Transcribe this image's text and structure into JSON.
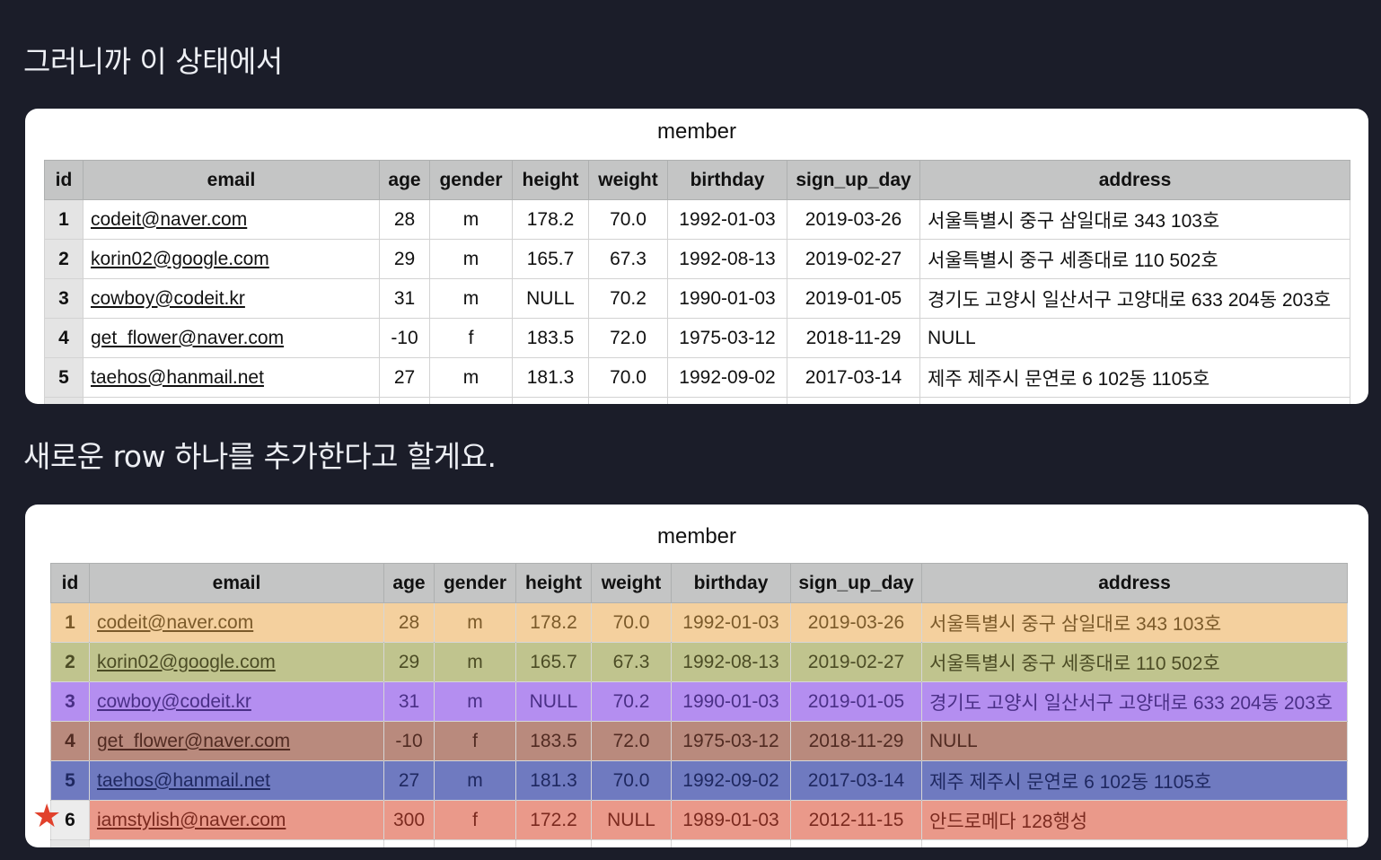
{
  "headings": {
    "first": "그러니까 이 상태에서",
    "second": "새로운 row 하나를 추가한다고 할게요."
  },
  "table1": {
    "title": "member",
    "columns": [
      "id",
      "email",
      "age",
      "gender",
      "height",
      "weight",
      "birthday",
      "sign_up_day",
      "address"
    ],
    "rows": [
      [
        "1",
        "codeit@naver.com",
        "28",
        "m",
        "178.2",
        "70.0",
        "1992-01-03",
        "2019-03-26",
        "서울특별시 중구 삼일대로 343 103호"
      ],
      [
        "2",
        "korin02@google.com",
        "29",
        "m",
        "165.7",
        "67.3",
        "1992-08-13",
        "2019-02-27",
        "서울특별시 중구 세종대로 110 502호"
      ],
      [
        "3",
        "cowboy@codeit.kr",
        "31",
        "m",
        "NULL",
        "70.2",
        "1990-01-03",
        "2019-01-05",
        "경기도 고양시 일산서구 고양대로 633 204동 203호"
      ],
      [
        "4",
        "get_flower@naver.com",
        "-10",
        "f",
        "183.5",
        "72.0",
        "1975-03-12",
        "2018-11-29",
        "NULL"
      ],
      [
        "5",
        "taehos@hanmail.net",
        "27",
        "m",
        "181.3",
        "70.0",
        "1992-09-02",
        "2017-03-14",
        "제주 제주시 문연로 6 102동 1105호"
      ]
    ]
  },
  "table2": {
    "title": "member",
    "columns": [
      "id",
      "email",
      "age",
      "gender",
      "height",
      "weight",
      "birthday",
      "sign_up_day",
      "address"
    ],
    "rows": [
      [
        "1",
        "codeit@naver.com",
        "28",
        "m",
        "178.2",
        "70.0",
        "1992-01-03",
        "2019-03-26",
        "서울특별시 중구 삼일대로 343 103호"
      ],
      [
        "2",
        "korin02@google.com",
        "29",
        "m",
        "165.7",
        "67.3",
        "1992-08-13",
        "2019-02-27",
        "서울특별시 중구 세종대로 110 502호"
      ],
      [
        "3",
        "cowboy@codeit.kr",
        "31",
        "m",
        "NULL",
        "70.2",
        "1990-01-03",
        "2019-01-05",
        "경기도 고양시 일산서구 고양대로 633 204동 203호"
      ],
      [
        "4",
        "get_flower@naver.com",
        "-10",
        "f",
        "183.5",
        "72.0",
        "1975-03-12",
        "2018-11-29",
        "NULL"
      ],
      [
        "5",
        "taehos@hanmail.net",
        "27",
        "m",
        "181.3",
        "70.0",
        "1992-09-02",
        "2017-03-14",
        "제주 제주시 문연로 6 102동 1105호"
      ],
      [
        "6",
        "iamstylish@naver.com",
        "300",
        "f",
        "172.2",
        "NULL",
        "1989-01-03",
        "2012-11-15",
        "안드로메다 128행성"
      ]
    ],
    "new_row_marker_icon": "star-icon",
    "row_colors": [
      "#f4d09e",
      "#c0c48e",
      "#b48ef0",
      "#b98a7d",
      "#6f7ac0",
      "#ea998a"
    ]
  },
  "colors": {
    "page_background": "#1b1d29",
    "header_background": "#c4c5c5",
    "star": "#e1412c"
  }
}
